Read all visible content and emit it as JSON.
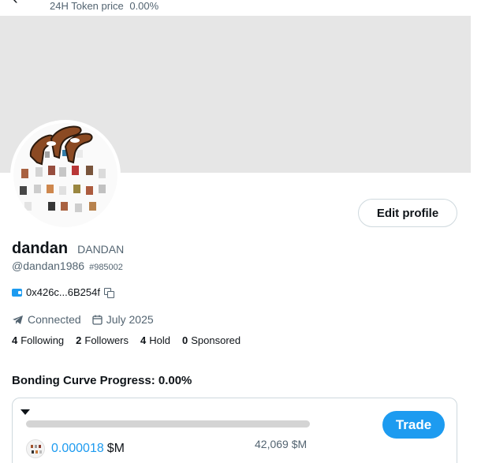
{
  "header": {
    "back_icon": "arrow-left-icon",
    "token_price_label": "24H Token price",
    "token_price_value": "0.00%"
  },
  "profile": {
    "display_name": "dandan",
    "ticker": "DANDAN",
    "handle": "@dandan1986",
    "user_id": "#985002",
    "wallet_address": "0x426c...6B254f",
    "status": "Connected",
    "joined": "July 2025",
    "edit_label": "Edit profile"
  },
  "stats": [
    {
      "count": "4",
      "label": "Following"
    },
    {
      "count": "2",
      "label": "Followers"
    },
    {
      "count": "4",
      "label": "Hold"
    },
    {
      "count": "0",
      "label": "Sponsored"
    }
  ],
  "bonding": {
    "title": "Bonding Curve Progress: 0.00%",
    "progress_fraction": 0,
    "trade_label": "Trade",
    "market_value": "0.000018",
    "market_unit": "$M",
    "cap": "42,069 $M"
  },
  "colors": {
    "accent": "#1d9bf0",
    "banner": "#e6e6e6"
  }
}
